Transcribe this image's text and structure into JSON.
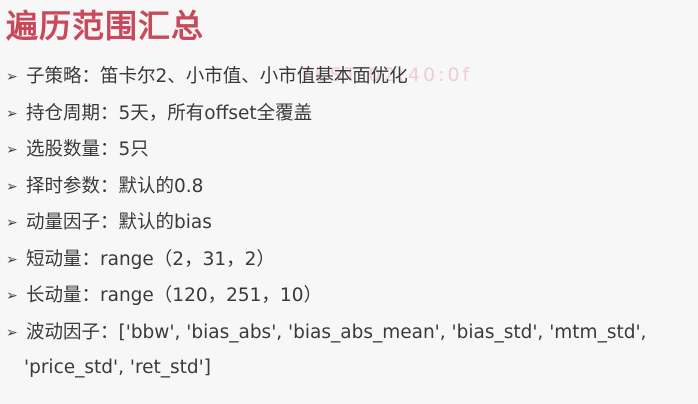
{
  "title": "遍历范围汇总",
  "watermark": "TEST 02:40:0f",
  "bullet_glyph": "➢",
  "items": [
    {
      "label": "子策略：",
      "value": "笛卡尔2、小市值、小市值基本面优化"
    },
    {
      "label": "持仓周期：",
      "value": "5天，所有offset全覆盖"
    },
    {
      "label": "选股数量：",
      "value": "5只"
    },
    {
      "label": "择时参数：",
      "value": "默认的0.8"
    },
    {
      "label": "动量因子：",
      "value": "默认的bias"
    },
    {
      "label": "短动量：",
      "value": "range（2，31，2）"
    },
    {
      "label": "长动量：",
      "value": "range（120，251，10）"
    },
    {
      "label": "波动因子：",
      "value": "['bbw', 'bias_abs', 'bias_abs_mean', 'bias_std', 'mtm_std',",
      "value_line2": "'price_std', 'ret_std']"
    }
  ]
}
